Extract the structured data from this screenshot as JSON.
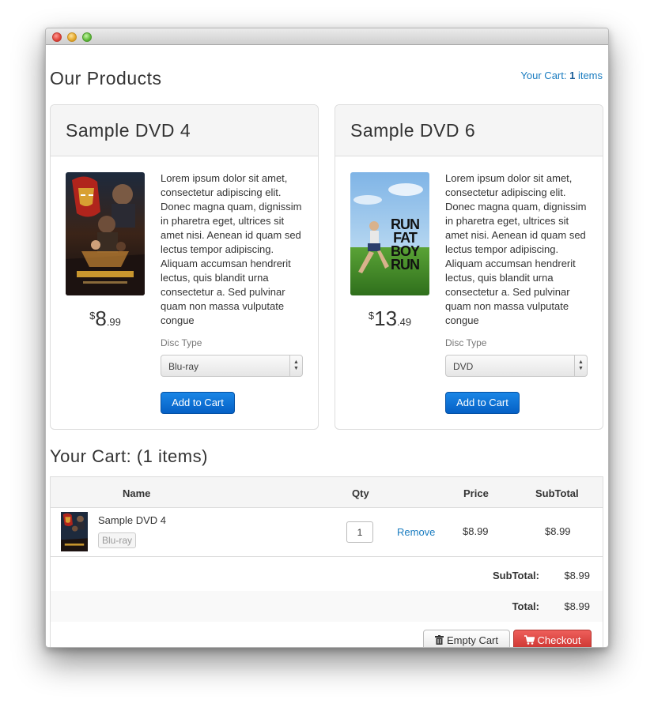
{
  "header": {
    "page_title": "Our Products",
    "cart_link_prefix": "Your Cart: ",
    "cart_count": "1",
    "cart_link_suffix": " items"
  },
  "products": [
    {
      "title": "Sample DVD 4",
      "poster": "iron-man-poster",
      "price_currency": "$",
      "price_whole": "8",
      "price_cents": ".99",
      "description": "Lorem ipsum dolor sit amet, consectetur adipiscing elit. Donec magna quam, dignissim in pharetra eget, ultrices sit amet nisi. Aenean id quam sed lectus tempor adipiscing. Aliquam accumsan hendrerit lectus, quis blandit urna consectetur a. Sed pulvinar quam non massa vulputate congue",
      "disc_type_label": "Disc Type",
      "disc_type_value": "Blu-ray",
      "add_button": "Add to Cart"
    },
    {
      "title": "Sample DVD 6",
      "poster": "run-fat-boy-run-poster",
      "price_currency": "$",
      "price_whole": "13",
      "price_cents": ".49",
      "description": "Lorem ipsum dolor sit amet, consectetur adipiscing elit. Donec magna quam, dignissim in pharetra eget, ultrices sit amet nisi. Aenean id quam sed lectus tempor adipiscing. Aliquam accumsan hendrerit lectus, quis blandit urna consectetur a. Sed pulvinar quam non massa vulputate congue",
      "disc_type_label": "Disc Type",
      "disc_type_value": "DVD",
      "add_button": "Add to Cart",
      "poster_text": [
        "RUN",
        "FAT",
        "BOY",
        "RUN"
      ]
    }
  ],
  "cart": {
    "title": "Your Cart: (1 items)",
    "columns": {
      "name": "Name",
      "qty": "Qty",
      "price": "Price",
      "subtotal": "SubTotal"
    },
    "items": [
      {
        "name": "Sample DVD 4",
        "tag": "Blu-ray",
        "qty": "1",
        "remove": "Remove",
        "price": "$8.99",
        "subtotal": "$8.99"
      }
    ],
    "subtotal_label": "SubTotal:",
    "subtotal_value": "$8.99",
    "total_label": "Total:",
    "total_value": "$8.99",
    "empty_button": "Empty Cart",
    "checkout_button": "Checkout"
  },
  "colors": {
    "link": "#1a7cc0",
    "primary": "#0560c5",
    "danger": "#d9534f"
  }
}
